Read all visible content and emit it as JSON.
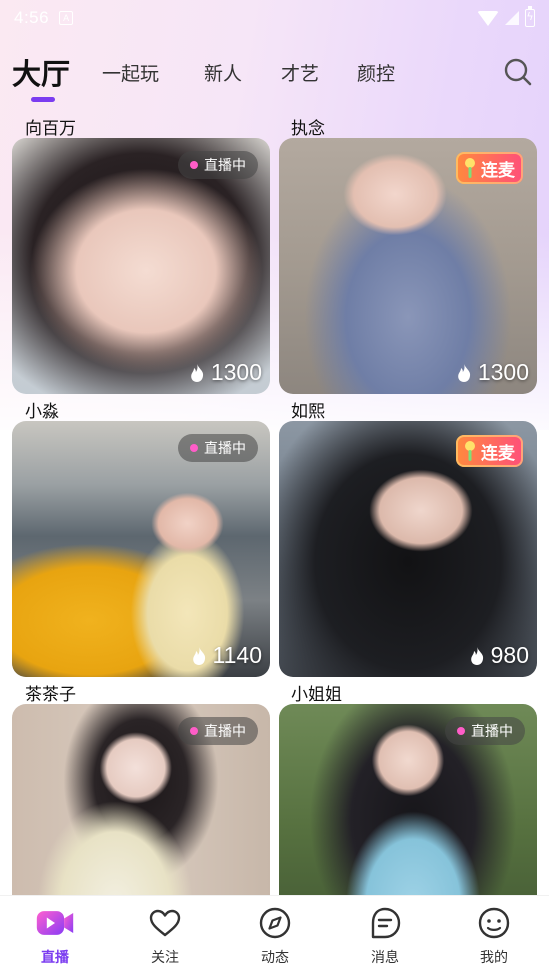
{
  "status_bar": {
    "time": "4:56"
  },
  "top_tabs": [
    {
      "label": "大厅",
      "active": true
    },
    {
      "label": "一起玩",
      "active": false
    },
    {
      "label": "新人",
      "active": false
    },
    {
      "label": "才艺",
      "active": false
    },
    {
      "label": "颜控",
      "active": false
    }
  ],
  "search_icon": "search-icon",
  "cards": [
    {
      "name": "向百万",
      "badge": "直播中",
      "badge_type": "live",
      "heat": "1300"
    },
    {
      "name": "执念",
      "badge": "连麦",
      "badge_type": "mic",
      "heat": "1300"
    },
    {
      "name": "小淼",
      "badge": "直播中",
      "badge_type": "live",
      "heat": "1140"
    },
    {
      "name": "如熙",
      "badge": "连麦",
      "badge_type": "mic",
      "heat": "980"
    },
    {
      "name": "茶茶子",
      "badge": "直播中",
      "badge_type": "live",
      "heat": ""
    },
    {
      "name": "小姐姐",
      "badge": "直播中",
      "badge_type": "live",
      "heat": ""
    }
  ],
  "bottom_nav": [
    {
      "label": "直播",
      "icon": "live-video-icon",
      "active": true
    },
    {
      "label": "关注",
      "icon": "heart-icon",
      "active": false
    },
    {
      "label": "动态",
      "icon": "compass-icon",
      "active": false
    },
    {
      "label": "消息",
      "icon": "message-icon",
      "active": false
    },
    {
      "label": "我的",
      "icon": "profile-icon",
      "active": false
    }
  ],
  "colors": {
    "accent": "#7b3cf0",
    "live_dot": "#ff5dc8",
    "mic_badge": "#ff6a55"
  }
}
